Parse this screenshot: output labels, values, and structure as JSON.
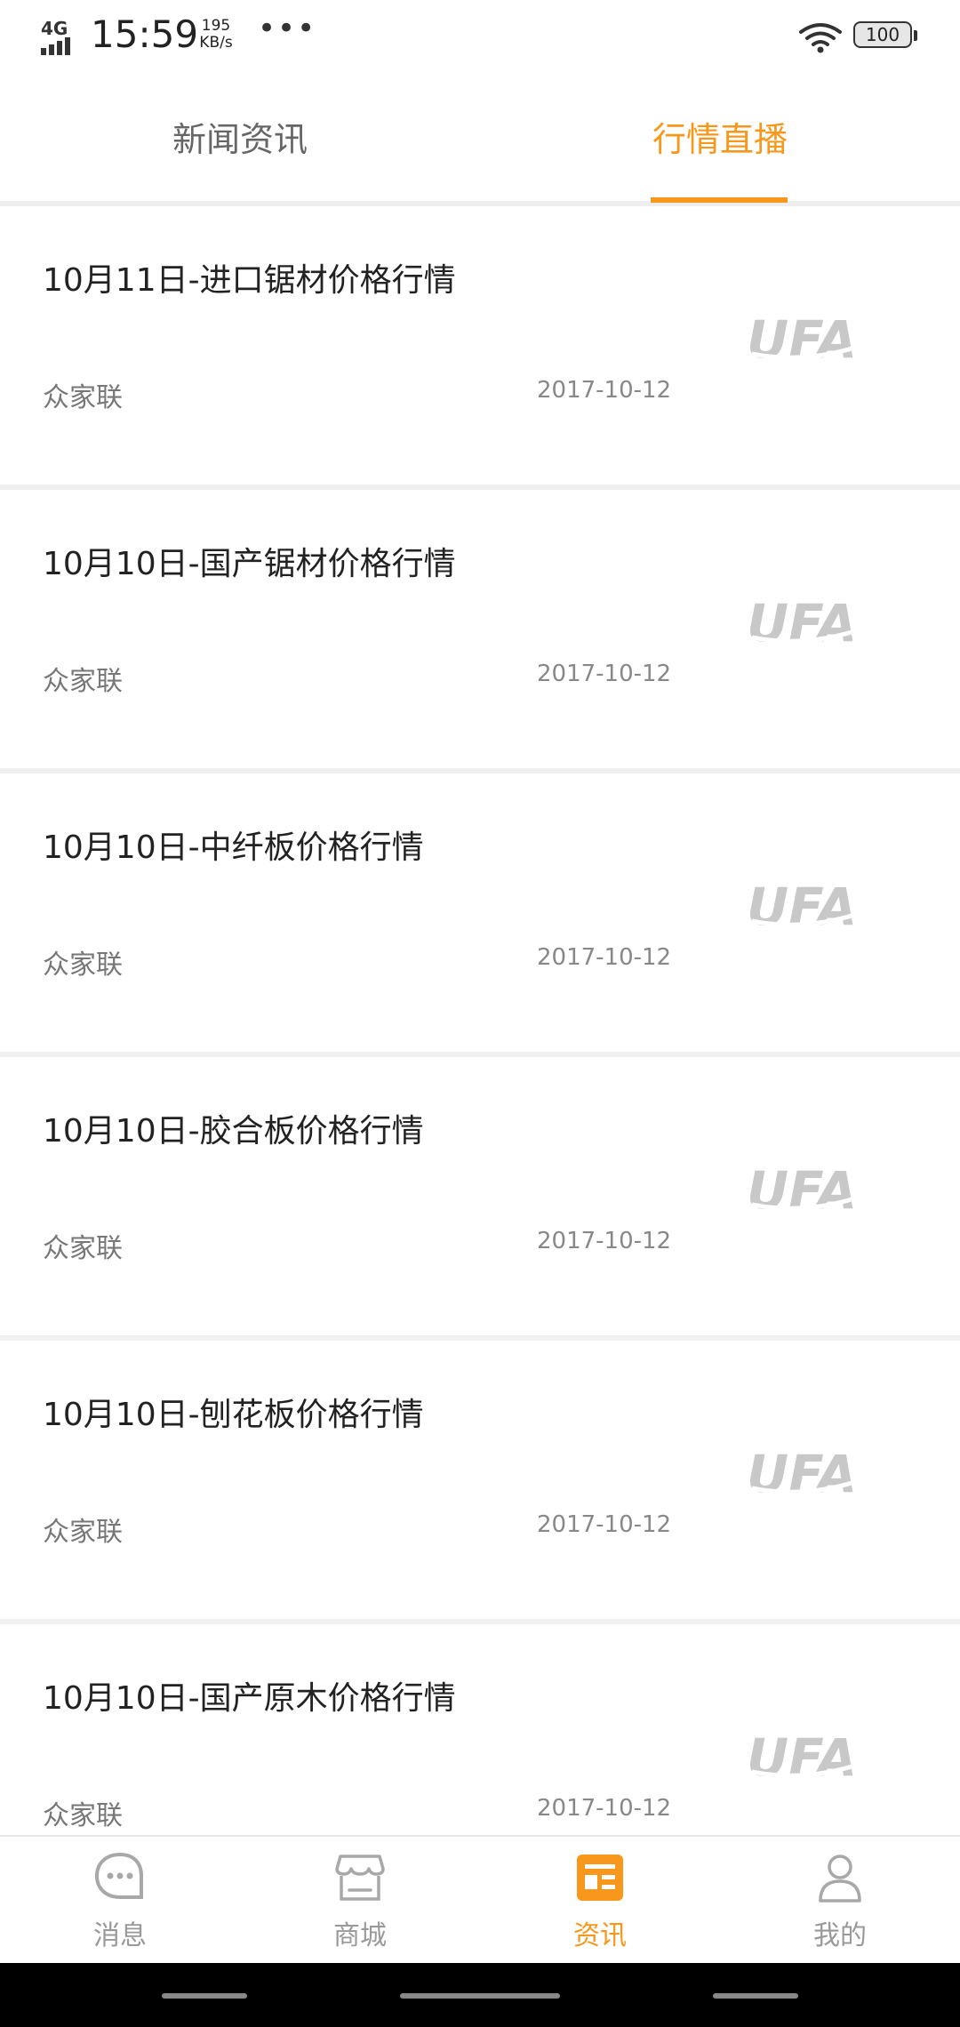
{
  "status_bar": {
    "network": "4G",
    "time": "15:59",
    "speed_value": "195",
    "speed_unit": "KB/s",
    "more": "•••",
    "battery": "100"
  },
  "tabs": {
    "news_label": "新闻资讯",
    "live_label": "行情直播",
    "active": "行情直播"
  },
  "list": {
    "items": [
      {
        "title": "10月11日-进口锯材价格行情",
        "source": "众家联",
        "date": "2017-10-12",
        "thumb": "UFA"
      },
      {
        "title": "10月10日-国产锯材价格行情",
        "source": "众家联",
        "date": "2017-10-12",
        "thumb": "UFA"
      },
      {
        "title": "10月10日-中纤板价格行情",
        "source": "众家联",
        "date": "2017-10-12",
        "thumb": "UFA"
      },
      {
        "title": "10月10日-胶合板价格行情",
        "source": "众家联",
        "date": "2017-10-12",
        "thumb": "UFA"
      },
      {
        "title": "10月10日-刨花板价格行情",
        "source": "众家联",
        "date": "2017-10-12",
        "thumb": "UFA"
      },
      {
        "title": "10月10日-国产原木价格行情",
        "source": "众家联",
        "date": "2017-10-12",
        "thumb": "UFA"
      }
    ]
  },
  "bottom_nav": {
    "items": [
      {
        "label": "消息",
        "icon": "chat-bubble-icon"
      },
      {
        "label": "商城",
        "icon": "store-icon"
      },
      {
        "label": "资讯",
        "icon": "news-icon"
      },
      {
        "label": "我的",
        "icon": "person-icon"
      }
    ],
    "active": "资讯"
  },
  "colors": {
    "accent": "#f7981c",
    "text_primary": "#222222",
    "text_secondary": "#777777",
    "divider": "#eeeeee"
  }
}
